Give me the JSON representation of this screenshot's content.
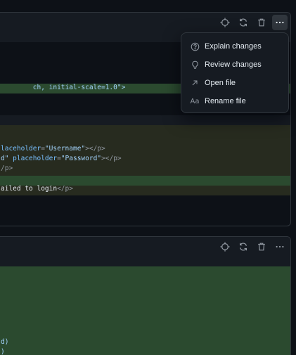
{
  "colors": {
    "page_bg": "#0d1117",
    "header_bg": "#161b22",
    "border": "#30363d",
    "added_bg": "#2b4a2f",
    "modified_bg": "#272b1f",
    "tag": "#7ee787",
    "attr": "#79c0ff",
    "string": "#a5d6ff",
    "text": "#e6edf3",
    "muted": "#9198a1"
  },
  "file_panels": [
    {
      "actions": [
        {
          "icon": "crosshair-icon",
          "label": "Locate"
        },
        {
          "icon": "refresh-icon",
          "label": "Revert"
        },
        {
          "icon": "trash-icon",
          "label": "Delete"
        },
        {
          "icon": "kebab-icon",
          "label": "More options"
        }
      ],
      "code": {
        "line_viewport": "ch, initial-scale=1.0\">",
        "line_username": {
          "pre": "laceholder",
          "eq": "=",
          "val": "\"Username\"",
          "close": "></p>"
        },
        "line_password": {
          "pre": "d\" ",
          "attr": "placeholder",
          "eq": "=",
          "val": "\"Password\"",
          "close": "></p>"
        },
        "line_p_close": "/p>",
        "line_failed": {
          "text": "ailed to login",
          "close": "</p>"
        }
      }
    },
    {
      "actions": [
        {
          "icon": "crosshair-icon",
          "label": "Locate"
        },
        {
          "icon": "refresh-icon",
          "label": "Revert"
        },
        {
          "icon": "trash-icon",
          "label": "Delete"
        },
        {
          "icon": "kebab-icon",
          "label": "More options"
        }
      ],
      "code": {
        "line_1": "d)",
        "line_2": ")"
      }
    }
  ],
  "menu": {
    "items": [
      {
        "icon": "question-circle-icon",
        "label": "Explain changes"
      },
      {
        "icon": "lightbulb-icon",
        "label": "Review changes"
      },
      {
        "icon": "arrow-up-right-icon",
        "label": "Open file"
      },
      {
        "icon": "rename-icon",
        "label": "Rename file",
        "glyph": "Aa"
      }
    ]
  }
}
